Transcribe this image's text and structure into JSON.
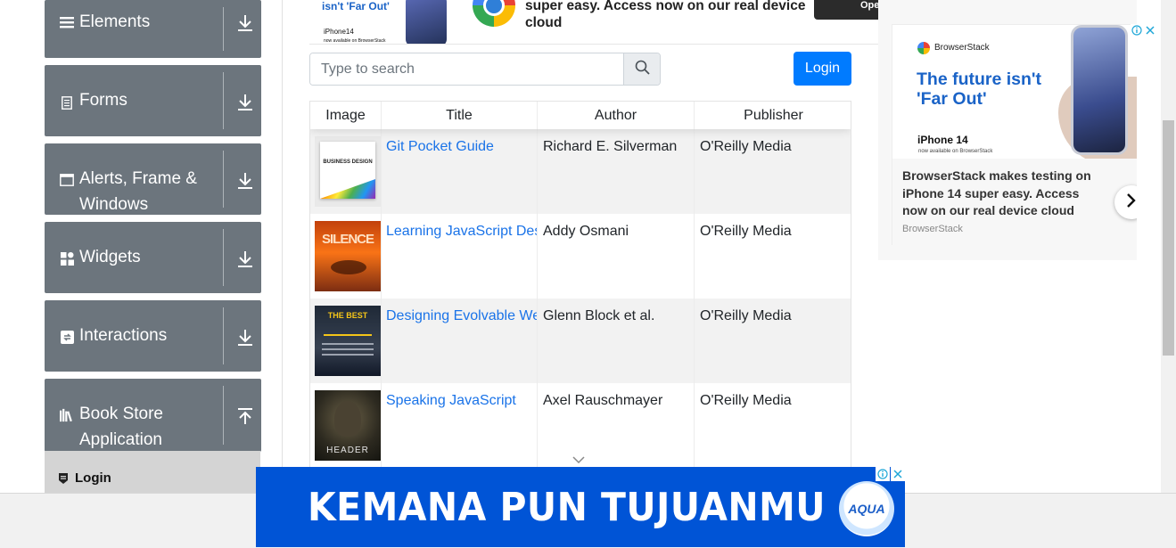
{
  "sidebar": {
    "groups": [
      {
        "label": "Elements",
        "icon": "menu-icon",
        "expanded": false
      },
      {
        "label": "Forms",
        "icon": "form-icon",
        "expanded": false
      },
      {
        "label": "Alerts, Frame & Windows",
        "icon": "window-icon",
        "expanded": false
      },
      {
        "label": "Widgets",
        "icon": "widgets-icon",
        "expanded": false
      },
      {
        "label": "Interactions",
        "icon": "interactions-icon",
        "expanded": false
      },
      {
        "label": "Book Store Application",
        "icon": "books-icon",
        "expanded": true
      }
    ],
    "active_item": "Login"
  },
  "top_ad": {
    "headline_fragment": "isn't 'Far Out'",
    "device": "iPhone14",
    "device_note": "now available on BrowserStack",
    "text": "super easy. Access now on our real device cloud",
    "button_fragment": "Ope"
  },
  "search": {
    "placeholder": "Type to search",
    "value": ""
  },
  "login_button": "Login",
  "table": {
    "columns": [
      "Image",
      "Title",
      "Author",
      "Publisher"
    ],
    "rows": [
      {
        "cover_text": "BUSINESS DESIGN",
        "title": "Git Pocket Guide",
        "author": "Richard E. Silverman",
        "publisher": "O'Reilly Media"
      },
      {
        "cover_text": "SILENCE",
        "title": "Learning JavaScript Desi",
        "author": "Addy Osmani",
        "publisher": "O'Reilly Media"
      },
      {
        "cover_text": "THE BEST",
        "title": "Designing Evolvable We",
        "author": "Glenn Block et al.",
        "publisher": "O'Reilly Media"
      },
      {
        "cover_text": "HEADER",
        "title": "Speaking JavaScript",
        "author": "Axel Rauschmayer",
        "publisher": "O'Reilly Media"
      }
    ]
  },
  "side_ad": {
    "brand": "BrowserStack",
    "headline": "The future isn't 'Far Out'",
    "device": "iPhone 14",
    "device_note": "now available on BrowserStack",
    "body": "BrowserStack makes testing on iPhone 14 super easy. Access now on our real device cloud",
    "source": "BrowserStack"
  },
  "bottom_ad": {
    "text": "KEMANA PUN TUJUANMU",
    "logo": "AQUA"
  },
  "colors": {
    "sidebar_group": "#6c757d",
    "primary_button": "#007bff",
    "link": "#1a73e8",
    "bottom_ad": "#0054d6"
  }
}
